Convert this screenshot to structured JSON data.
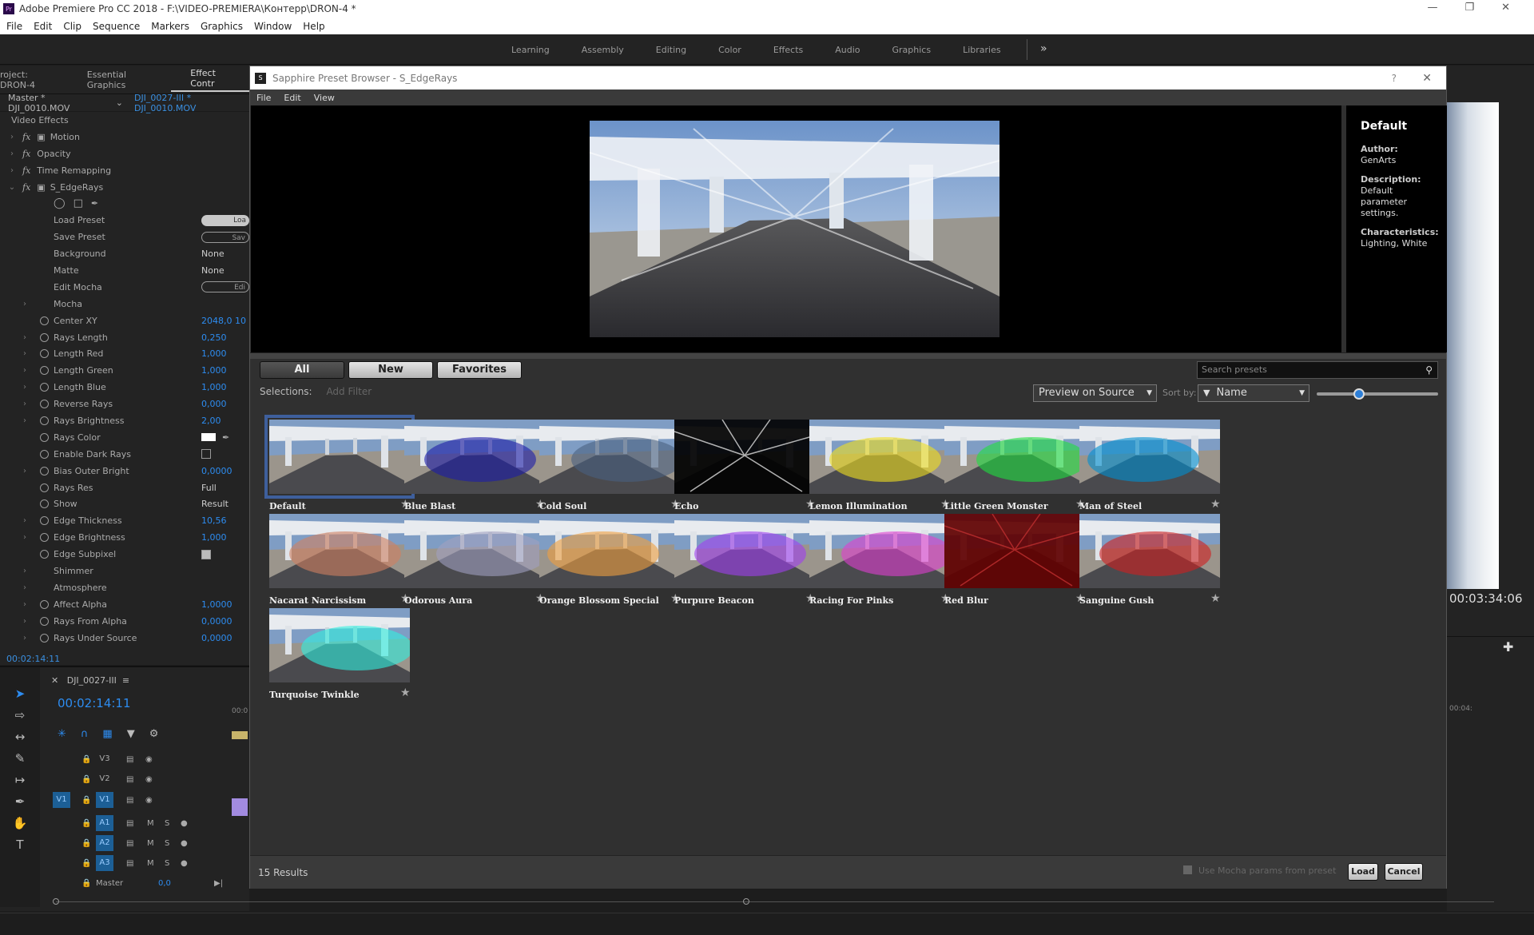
{
  "app": {
    "title": "Adobe Premiere Pro CC 2018 - F:\\VIDEO-PREMIERA\\Контерр\\DRON-4 *"
  },
  "menu": [
    "File",
    "Edit",
    "Clip",
    "Sequence",
    "Markers",
    "Graphics",
    "Window",
    "Help"
  ],
  "workspaces": [
    "Learning",
    "Assembly",
    "Editing",
    "Color",
    "Effects",
    "Audio",
    "Graphics",
    "Libraries"
  ],
  "left_panel": {
    "tabs": [
      "roject: DRON-4",
      "Essential Graphics",
      "Effect Contr"
    ],
    "master": "Master * DJI_0010.MOV",
    "clip": "DJI_0027-III * DJI_0010.MOV",
    "section": "Video Effects",
    "effects": [
      {
        "label": "Motion",
        "indent": 1,
        "fx": true
      },
      {
        "label": "Opacity",
        "indent": 1,
        "fx": true
      },
      {
        "label": "Time Remapping",
        "indent": 1,
        "fx": true
      },
      {
        "label": "S_EdgeRays",
        "indent": 1,
        "fx": true,
        "open": true
      },
      {
        "label": "",
        "indent": 2,
        "masks": true
      },
      {
        "label": "Load Preset",
        "indent": 2,
        "sw": "Loa"
      },
      {
        "label": "Save Preset",
        "indent": 2,
        "sw": "Sav",
        "outline": true
      },
      {
        "label": "Background",
        "indent": 2,
        "value": "None",
        "white": true
      },
      {
        "label": "Matte",
        "indent": 2,
        "value": "None",
        "white": true
      },
      {
        "label": "Edit Mocha",
        "indent": 2,
        "sw": "Edi",
        "outline": true
      },
      {
        "label": "Mocha",
        "indent": 2,
        "ex": true
      },
      {
        "label": "Center XY",
        "indent": 2,
        "stop": true,
        "value": "2048,0   10"
      },
      {
        "label": "Rays Length",
        "indent": 2,
        "stop": true,
        "ex": true,
        "value": "0,250"
      },
      {
        "label": "Length Red",
        "indent": 2,
        "stop": true,
        "ex": true,
        "value": "1,000"
      },
      {
        "label": "Length Green",
        "indent": 2,
        "stop": true,
        "ex": true,
        "value": "1,000"
      },
      {
        "label": "Length Blue",
        "indent": 2,
        "stop": true,
        "ex": true,
        "value": "1,000"
      },
      {
        "label": "Reverse Rays",
        "indent": 2,
        "stop": true,
        "ex": true,
        "value": "0,000"
      },
      {
        "label": "Rays Brightness",
        "indent": 2,
        "stop": true,
        "ex": true,
        "value": "2,00"
      },
      {
        "label": "Rays Color",
        "indent": 2,
        "stop": true,
        "color": true
      },
      {
        "label": "Enable Dark Rays",
        "indent": 2,
        "stop": true,
        "cb": false
      },
      {
        "label": "Bias Outer Bright",
        "indent": 2,
        "stop": true,
        "ex": true,
        "value": "0,0000"
      },
      {
        "label": "Rays Res",
        "indent": 2,
        "stop": true,
        "value": "Full",
        "white": true
      },
      {
        "label": "Show",
        "indent": 2,
        "stop": true,
        "value": "Result",
        "white": true
      },
      {
        "label": "Edge Thickness",
        "indent": 2,
        "stop": true,
        "ex": true,
        "value": "10,56"
      },
      {
        "label": "Edge Brightness",
        "indent": 2,
        "stop": true,
        "ex": true,
        "value": "1,000"
      },
      {
        "label": "Edge Subpixel",
        "indent": 2,
        "stop": true,
        "cb": true
      },
      {
        "label": "Shimmer",
        "indent": 2,
        "ex": true
      },
      {
        "label": "Atmosphere",
        "indent": 2,
        "ex": true
      },
      {
        "label": "Affect Alpha",
        "indent": 2,
        "stop": true,
        "ex": true,
        "value": "1,0000"
      },
      {
        "label": "Rays From Alpha",
        "indent": 2,
        "stop": true,
        "ex": true,
        "value": "0,0000"
      },
      {
        "label": "Rays Under Source",
        "indent": 2,
        "stop": true,
        "ex": true,
        "value": "0,0000"
      }
    ],
    "timecode": "00:02:14:11"
  },
  "timeline": {
    "name": "DJI_0027-III",
    "timecode": "00:02:14:11",
    "tracks": [
      {
        "label": "V3",
        "active": false
      },
      {
        "label": "V2",
        "active": false
      },
      {
        "label": "V1",
        "active": true
      },
      {
        "label": "A1",
        "active": true
      },
      {
        "label": "A2",
        "active": true
      },
      {
        "label": "A3",
        "active": true
      }
    ],
    "master_label": "Master",
    "master_value": "0,0",
    "ruler": "00:0",
    "ruler_right": "00:04:"
  },
  "dialog": {
    "title": "Sapphire Preset Browser - S_EdgeRays",
    "menu": [
      "File",
      "Edit",
      "View"
    ],
    "info": {
      "name": "Default",
      "author_label": "Author:",
      "author": "GenArts",
      "desc_label": "Description:",
      "desc": "Default parameter settings.",
      "char_label": "Characteristics:",
      "char": "Lighting, White"
    },
    "filters": [
      "All",
      "New",
      "Favorites"
    ],
    "search_placeholder": "Search presets",
    "selections_label": "Selections:",
    "add_filter": "Add Filter",
    "preview_mode": "Preview on Source",
    "sort_label": "Sort by:",
    "sort_value": "Name",
    "size_level": 0.35,
    "presets": [
      {
        "name": "Default",
        "tint": "none"
      },
      {
        "name": "Blue Blast",
        "tint": "#1c1ca8"
      },
      {
        "name": "Cold Soul",
        "tint": "#4a6080"
      },
      {
        "name": "Echo",
        "tint": "#000000"
      },
      {
        "name": "Lemon Illumination",
        "tint": "#f0e020"
      },
      {
        "name": "Little Green Monster",
        "tint": "#20e040"
      },
      {
        "name": "Man of Steel",
        "tint": "#0090d0"
      },
      {
        "name": "Nacarat Narcissism",
        "tint": "#d08060"
      },
      {
        "name": "Odorous Aura",
        "tint": "#a0a0c0"
      },
      {
        "name": "Orange Blossom Special",
        "tint": "#f0a040"
      },
      {
        "name": "Purpure Beacon",
        "tint": "#a040f0"
      },
      {
        "name": "Racing For Pinks",
        "tint": "#e040d0"
      },
      {
        "name": "Red Blur",
        "tint": "#600000"
      },
      {
        "name": "Sanguine Gush",
        "tint": "#d02020"
      },
      {
        "name": "Turquoise Twinkle",
        "tint": "#30f0e0"
      }
    ],
    "results": "15 Results",
    "mocha_label": "Use Mocha params from preset",
    "load": "Load",
    "cancel": "Cancel"
  },
  "right_panel": {
    "timecode": "00:03:34:06"
  },
  "colors": {
    "accent": "#2d8cf0",
    "selection": "#3e5f9c"
  }
}
